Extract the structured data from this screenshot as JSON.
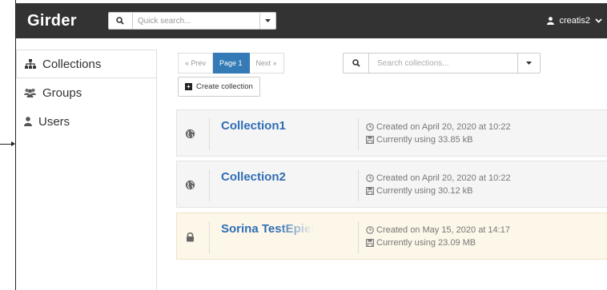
{
  "navbar": {
    "brand": "Girder",
    "quick_search_placeholder": "Quick search...",
    "user_name": "creatis2"
  },
  "sidebar": {
    "items": [
      {
        "label": "Collections",
        "icon": "sitemap-icon"
      },
      {
        "label": "Groups",
        "icon": "users-icon"
      },
      {
        "label": "Users",
        "icon": "user-icon"
      }
    ]
  },
  "pager": {
    "prev": "« Prev",
    "page": "Page 1",
    "next": "Next »"
  },
  "toolbar": {
    "create_label": "Create collection",
    "search_placeholder": "Search collections..."
  },
  "collections": [
    {
      "name": "Collection1",
      "access": "public",
      "created": "Created on April 20, 2020 at 10:22",
      "usage": "Currently using 33.85 kB"
    },
    {
      "name": "Collection2",
      "access": "public",
      "created": "Created on April 20, 2020 at 10:22",
      "usage": "Currently using 30.12 kB"
    },
    {
      "name": "Sorina TestEpiel",
      "access": "private",
      "created": "Created on May 15, 2020 at 14:17",
      "usage": "Currently using 23.09 MB"
    }
  ],
  "colors": {
    "navbar_bg": "#333333",
    "link": "#2f6db5",
    "active_page": "#337ab7",
    "private_row_bg": "#fdf7e9"
  }
}
